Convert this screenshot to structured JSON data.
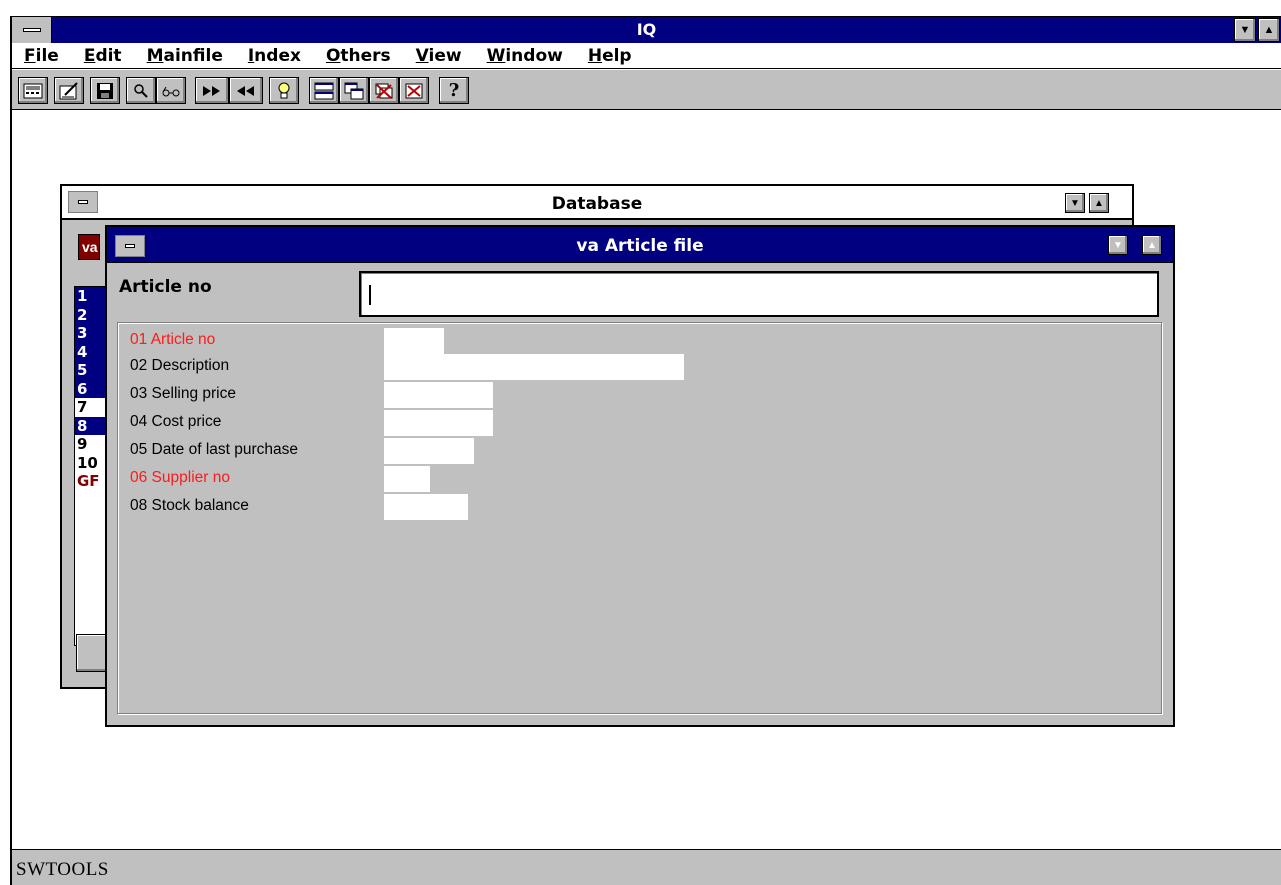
{
  "app": {
    "title": "IQ",
    "menu": [
      "File",
      "Edit",
      "Mainfile",
      "Index",
      "Others",
      "View",
      "Window",
      "Help"
    ],
    "toolbar_icons": [
      "calculator-icon",
      "edit-form-icon",
      "save-icon",
      "search-icon",
      "glasses-icon",
      "forward-icon",
      "back-icon",
      "lightbulb-icon",
      "tile-icon",
      "cascade-icon",
      "close-red-icon",
      "close-box-icon",
      "help-question-icon"
    ],
    "status": "SWTOOLS"
  },
  "database_window": {
    "title": "Database",
    "badge": "va",
    "list": [
      {
        "label": "1",
        "selected": true
      },
      {
        "label": "2",
        "selected": true
      },
      {
        "label": "3",
        "selected": true
      },
      {
        "label": "4",
        "selected": true
      },
      {
        "label": "5",
        "selected": true
      },
      {
        "label": "6",
        "selected": true
      },
      {
        "label": "7",
        "selected": false
      },
      {
        "label": "8",
        "selected": true
      },
      {
        "label": "9",
        "selected": false
      },
      {
        "label": "10",
        "selected": false
      },
      {
        "label": "GF",
        "selected": false
      }
    ]
  },
  "article_window": {
    "title": "va Article file",
    "search_label": "Article no",
    "search_value": "",
    "fields": [
      {
        "label": "01 Article no",
        "color": "#ff1a1a"
      },
      {
        "label": "02 Description",
        "color": "#000000"
      },
      {
        "label": "03 Selling price",
        "color": "#000000"
      },
      {
        "label": "04 Cost price",
        "color": "#000000"
      },
      {
        "label": "05 Date of last purchase",
        "color": "#000000"
      },
      {
        "label": "06 Supplier no",
        "color": "#ff1a1a"
      },
      {
        "label": "08 Stock balance",
        "color": "#000000"
      }
    ]
  },
  "colors": {
    "title_active": "#000080",
    "face": "#c0c0c0",
    "key_field": "#ff1a1a"
  }
}
